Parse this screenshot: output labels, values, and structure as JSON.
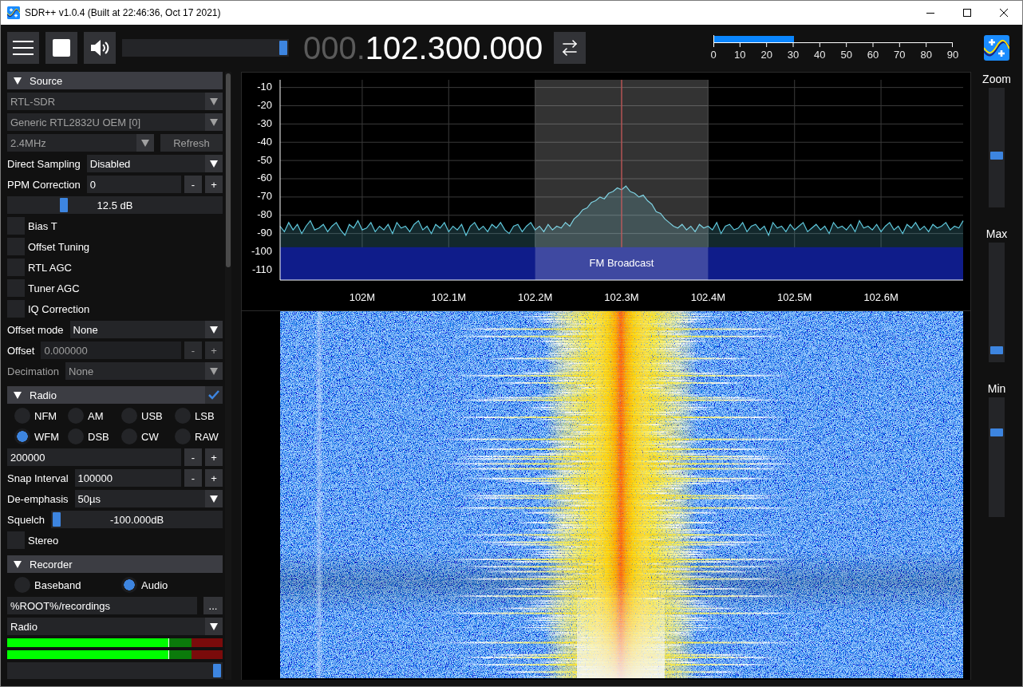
{
  "window": {
    "title": "SDR++ v1.0.4 (Built at 22:46:36, Oct 17 2021)"
  },
  "toolbar": {
    "playing": true,
    "volume": {
      "level": 1
    },
    "frequency": {
      "prefix": "000.",
      "value": "102.300.000"
    },
    "snr_meter": {
      "level": 0.333,
      "ticks": [
        "0",
        "10",
        "20",
        "30",
        "40",
        "50",
        "60",
        "70",
        "80",
        "90"
      ]
    }
  },
  "sidebar": {
    "sections": [
      {
        "title": "Source",
        "expanded": true,
        "rows": [
          {
            "kind": "combo",
            "value": "RTL-SDR",
            "disabled": true
          },
          {
            "kind": "combo",
            "value": "Generic RTL2832U OEM [0]",
            "disabled": true
          },
          {
            "kind": "combo_button",
            "value": "2.4MHz",
            "button": "Refresh",
            "disabled": true
          },
          {
            "kind": "combo",
            "label": "Direct Sampling",
            "value": "Disabled",
            "disabled": false
          },
          {
            "kind": "stepper",
            "label": "PPM Correction",
            "value": "0",
            "minus": "-",
            "plus": "+",
            "disabled": false
          },
          {
            "kind": "slider",
            "reading": "12.5 dB",
            "level": 0.25
          },
          {
            "kind": "checkbox",
            "label": "Bias T",
            "checked": false
          },
          {
            "kind": "checkbox",
            "label": "Offset Tuning",
            "checked": false
          },
          {
            "kind": "checkbox",
            "label": "RTL AGC",
            "checked": false
          },
          {
            "kind": "checkbox",
            "label": "Tuner AGC",
            "checked": false
          },
          {
            "kind": "checkbox",
            "label": "IQ Correction",
            "checked": false
          },
          {
            "kind": "combo",
            "label": "Offset mode",
            "value": "None",
            "disabled": false
          },
          {
            "kind": "stepper",
            "label": "Offset",
            "value": "0.000000",
            "minus": "-",
            "plus": "+",
            "disabled": true
          },
          {
            "kind": "combo",
            "label": "Decimation",
            "value": "None",
            "disabled": true
          }
        ]
      },
      {
        "title": "Radio",
        "expanded": true,
        "enabled": true,
        "rows": [
          {
            "kind": "radio_group",
            "options": [
              {
                "label": "NFM",
                "selected": false
              },
              {
                "label": "AM",
                "selected": false
              },
              {
                "label": "USB",
                "selected": false
              },
              {
                "label": "LSB",
                "selected": false
              },
              {
                "label": "WFM",
                "selected": true
              },
              {
                "label": "DSB",
                "selected": false
              },
              {
                "label": "CW",
                "selected": false
              },
              {
                "label": "RAW",
                "selected": false
              }
            ]
          },
          {
            "kind": "stepper",
            "value": "200000",
            "minus": "-",
            "plus": "+",
            "disabled": false
          },
          {
            "kind": "stepper",
            "label": "Snap Interval",
            "value": "100000",
            "minus": "-",
            "plus": "+",
            "disabled": false
          },
          {
            "kind": "combo",
            "label": "De-emphasis",
            "value": "50µs",
            "disabled": false
          },
          {
            "kind": "slider",
            "label": "Squelch",
            "reading": "-100.000dB",
            "level": 0
          },
          {
            "kind": "checkbox",
            "label": "Stereo",
            "checked": false
          }
        ]
      },
      {
        "title": "Recorder",
        "expanded": true,
        "rows": [
          {
            "kind": "radio_group",
            "options": [
              {
                "label": "Baseband",
                "selected": false
              },
              {
                "label": "Audio",
                "selected": true
              }
            ]
          },
          {
            "kind": "input_button",
            "value": "%ROOT%/recordings",
            "button": "..."
          },
          {
            "kind": "combo",
            "value": "Radio",
            "disabled": false
          },
          {
            "kind": "meter",
            "level": 0.75
          },
          {
            "kind": "meter",
            "level": 0.75
          },
          {
            "kind": "slider",
            "level": 1
          }
        ]
      }
    ]
  },
  "spectrum": {
    "chart_data": {
      "type": "line",
      "grid": true,
      "xlim": [
        101.905,
        102.695
      ],
      "ylim": [
        -115.5,
        -5.8
      ],
      "xticks": [
        {
          "value": 102.0,
          "label": "102M"
        },
        {
          "value": 102.1,
          "label": "102.1M"
        },
        {
          "value": 102.2,
          "label": "102.2M"
        },
        {
          "value": 102.3,
          "label": "102.3M"
        },
        {
          "value": 102.4,
          "label": "102.4M"
        },
        {
          "value": 102.5,
          "label": "102.5M"
        },
        {
          "value": 102.6,
          "label": "102.6M"
        }
      ],
      "yticks": [
        -10,
        -20,
        -30,
        -40,
        -50,
        -60,
        -70,
        -80,
        -90,
        -100,
        -110
      ],
      "x": [
        101.905,
        101.91,
        101.915,
        101.92,
        101.925,
        101.93,
        101.935,
        101.94,
        101.945,
        101.95,
        101.955,
        101.96,
        101.965,
        101.97,
        101.975,
        101.98,
        101.985,
        101.99,
        101.995,
        102.0,
        102.005,
        102.01,
        102.015,
        102.02,
        102.025,
        102.03,
        102.035,
        102.04,
        102.045,
        102.05,
        102.055,
        102.06,
        102.065,
        102.07,
        102.075,
        102.08,
        102.085,
        102.09,
        102.095,
        102.1,
        102.105,
        102.11,
        102.115,
        102.12,
        102.125,
        102.13,
        102.135,
        102.14,
        102.145,
        102.15,
        102.155,
        102.16,
        102.165,
        102.17,
        102.175,
        102.18,
        102.185,
        102.19,
        102.195,
        102.2,
        102.205,
        102.21,
        102.215,
        102.22,
        102.225,
        102.23,
        102.235,
        102.24,
        102.245,
        102.25,
        102.255,
        102.26,
        102.265,
        102.27,
        102.275,
        102.28,
        102.285,
        102.29,
        102.295,
        102.3,
        102.305,
        102.31,
        102.315,
        102.32,
        102.325,
        102.33,
        102.335,
        102.34,
        102.345,
        102.35,
        102.355,
        102.36,
        102.365,
        102.37,
        102.375,
        102.38,
        102.385,
        102.39,
        102.395,
        102.4,
        102.405,
        102.41,
        102.415,
        102.42,
        102.425,
        102.43,
        102.435,
        102.44,
        102.445,
        102.45,
        102.455,
        102.46,
        102.465,
        102.47,
        102.475,
        102.48,
        102.485,
        102.49,
        102.495,
        102.5,
        102.505,
        102.51,
        102.515,
        102.52,
        102.525,
        102.53,
        102.535,
        102.54,
        102.545,
        102.55,
        102.555,
        102.56,
        102.565,
        102.57,
        102.575,
        102.58,
        102.585,
        102.59,
        102.595,
        102.6,
        102.605,
        102.61,
        102.615,
        102.62,
        102.625,
        102.63,
        102.635,
        102.64,
        102.645,
        102.65,
        102.655,
        102.66,
        102.665,
        102.67,
        102.675,
        102.68,
        102.685,
        102.69,
        102.695
      ],
      "series": [
        {
          "color": "#5fc8dc",
          "values": [
            -86,
            -89,
            -84,
            -88,
            -85,
            -90,
            -86,
            -83,
            -88,
            -87,
            -85,
            -89,
            -86,
            -84,
            -88,
            -91,
            -85,
            -87,
            -83,
            -88,
            -87,
            -84,
            -89,
            -86,
            -88,
            -85,
            -90,
            -84,
            -87,
            -86,
            -89,
            -85,
            -83,
            -88,
            -86,
            -90,
            -85,
            -87,
            -84,
            -89,
            -86,
            -88,
            -85,
            -91,
            -86,
            -84,
            -88,
            -86,
            -89,
            -85,
            -87,
            -84,
            -88,
            -90,
            -86,
            -85,
            -89,
            -86,
            -84,
            -88,
            -86,
            -89,
            -85,
            -88,
            -86,
            -87,
            -84,
            -86,
            -82,
            -80,
            -77,
            -76,
            -73,
            -72,
            -70,
            -71,
            -68,
            -67,
            -65,
            -66,
            -64,
            -67,
            -68,
            -70,
            -69,
            -72,
            -74,
            -78,
            -79,
            -82,
            -84,
            -86,
            -87,
            -85,
            -88,
            -86,
            -89,
            -85,
            -87,
            -86,
            -88,
            -84,
            -90,
            -86,
            -85,
            -88,
            -87,
            -84,
            -89,
            -86,
            -85,
            -88,
            -86,
            -91,
            -84,
            -87,
            -86,
            -89,
            -85,
            -88,
            -86,
            -84,
            -89,
            -87,
            -85,
            -88,
            -86,
            -90,
            -84,
            -87,
            -86,
            -88,
            -85,
            -89,
            -83,
            -87,
            -86,
            -88,
            -85,
            -89,
            -86,
            -84,
            -88,
            -86,
            -90,
            -85,
            -87,
            -84,
            -88,
            -86,
            -89,
            -85,
            -87,
            -86,
            -84,
            -88,
            -86,
            -87,
            -83
          ]
        }
      ],
      "bands": [
        {
          "axis": "y",
          "from": -115.5,
          "to": -97.5,
          "color": "#0f1c8a",
          "label": "FM Broadcast"
        },
        {
          "axis": "x",
          "from": 102.2,
          "to": 102.4,
          "color": "#ffffff"
        }
      ],
      "ref_lines": [
        {
          "axis": "x",
          "value": 102.3,
          "color": "#d42020"
        }
      ]
    }
  },
  "right_panel": {
    "sliders": [
      {
        "label": "Zoom",
        "level": 0.43
      },
      {
        "label": "Max",
        "level": 0.06
      },
      {
        "label": "Min",
        "level": 0.73
      }
    ]
  }
}
